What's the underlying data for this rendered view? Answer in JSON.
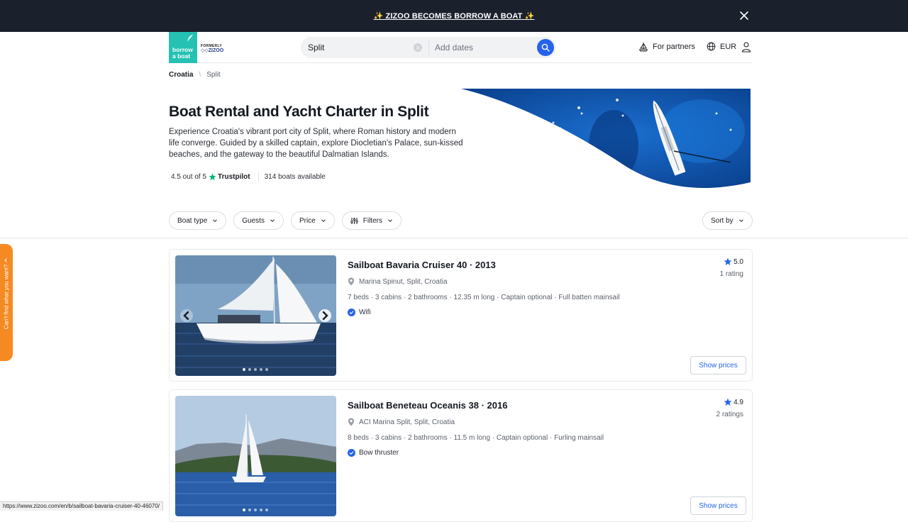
{
  "banner": {
    "text": "✨ ZIZOO BECOMES BORROW A BOAT ✨"
  },
  "logo": {
    "line1": "borrow",
    "line2": "a boat",
    "formerly": "FORMERLY",
    "zizoo": "◇◇ZIZOO"
  },
  "search": {
    "location": "Split",
    "dates_placeholder": "Add dates"
  },
  "nav": {
    "partners": "For partners",
    "currency": "EUR"
  },
  "breadcrumb": {
    "country": "Croatia",
    "separator": "\\",
    "city": "Split"
  },
  "hero": {
    "title": "Boat Rental and Yacht Charter in Split",
    "description": "Experience Croatia's vibrant port city of Split, where Roman history and modern life converge. Guided by a skilled captain, explore Diocletian's Palace, sun-kissed beaches, and the gateway to the beautiful Dalmatian Islands.",
    "rating": "4.5 out of 5",
    "trustpilot": "Trustpilot",
    "boats_available": "314 boats available"
  },
  "filters": {
    "boat_type": "Boat type",
    "guests": "Guests",
    "price": "Price",
    "filters": "Filters",
    "sort": "Sort by"
  },
  "side_tab": {
    "text": "Can't find what you want?"
  },
  "listings": [
    {
      "title": "Sailboat Bavaria Cruiser 40 · 2013",
      "location": "Marina Spinut, Split, Croatia",
      "specs": "7 beds · 3 cabins · 2 bathrooms · 12.35 m long · Captain optional · Full batten mainsail",
      "feature": "Wifi",
      "rating": "5.0",
      "rating_count": "1 rating",
      "button": "Show prices"
    },
    {
      "title": "Sailboat Beneteau Oceanis 38 · 2016",
      "location": "ACI Marina Split, Split, Croatia",
      "specs": "8 beds · 3 cabins · 2 bathrooms · 11.5 m long · Captain optional · Furling mainsail",
      "feature": "Bow thruster",
      "rating": "4.9",
      "rating_count": "2 ratings",
      "button": "Show prices"
    }
  ],
  "status": {
    "url": "https://www.zizoo.com/en/b/sailboat-bavaria-cruiser-40-46070/"
  },
  "colors": {
    "brand_teal": "#25c2b4",
    "accent_blue": "#2563eb",
    "banner_dark": "#1a202c",
    "side_tab_orange": "#f58a23",
    "trustpilot_green": "#00b67a"
  }
}
